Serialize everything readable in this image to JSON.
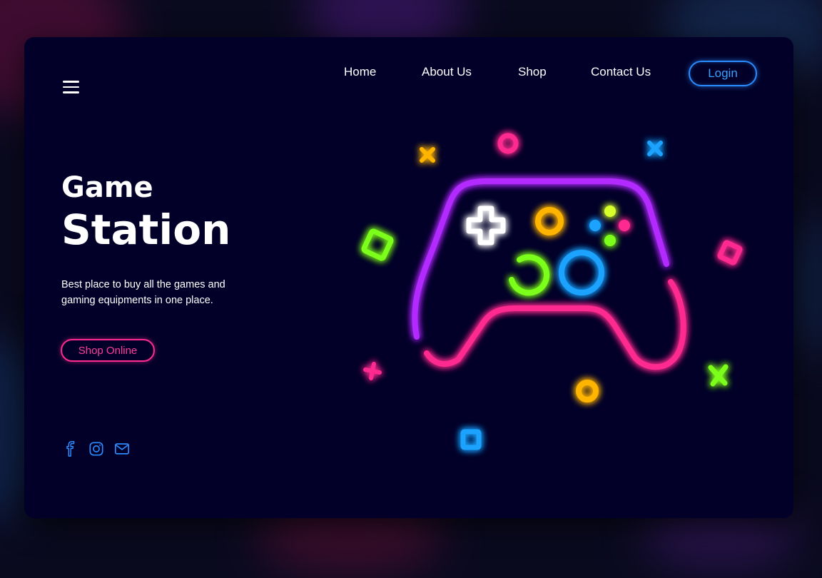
{
  "nav": {
    "menu_icon": "hamburger-menu-icon",
    "items": [
      {
        "label": "Home"
      },
      {
        "label": "About Us"
      },
      {
        "label": "Shop"
      },
      {
        "label": "Contact Us"
      }
    ],
    "login_label": "Login"
  },
  "hero": {
    "title_line1": "Game",
    "title_line2": "Station",
    "description": "Best place to buy all the games and gaming equipments in one place.",
    "cta_label": "Shop Online"
  },
  "social": [
    {
      "icon": "facebook-icon"
    },
    {
      "icon": "instagram-icon"
    },
    {
      "icon": "mail-icon"
    }
  ],
  "colors": {
    "background": "#020028",
    "accent_blue": "#2a8cff",
    "accent_pink": "#ff2a8f",
    "neon_purple": "#b22cff",
    "neon_green": "#7dff1a",
    "neon_yellow": "#ffb400"
  }
}
